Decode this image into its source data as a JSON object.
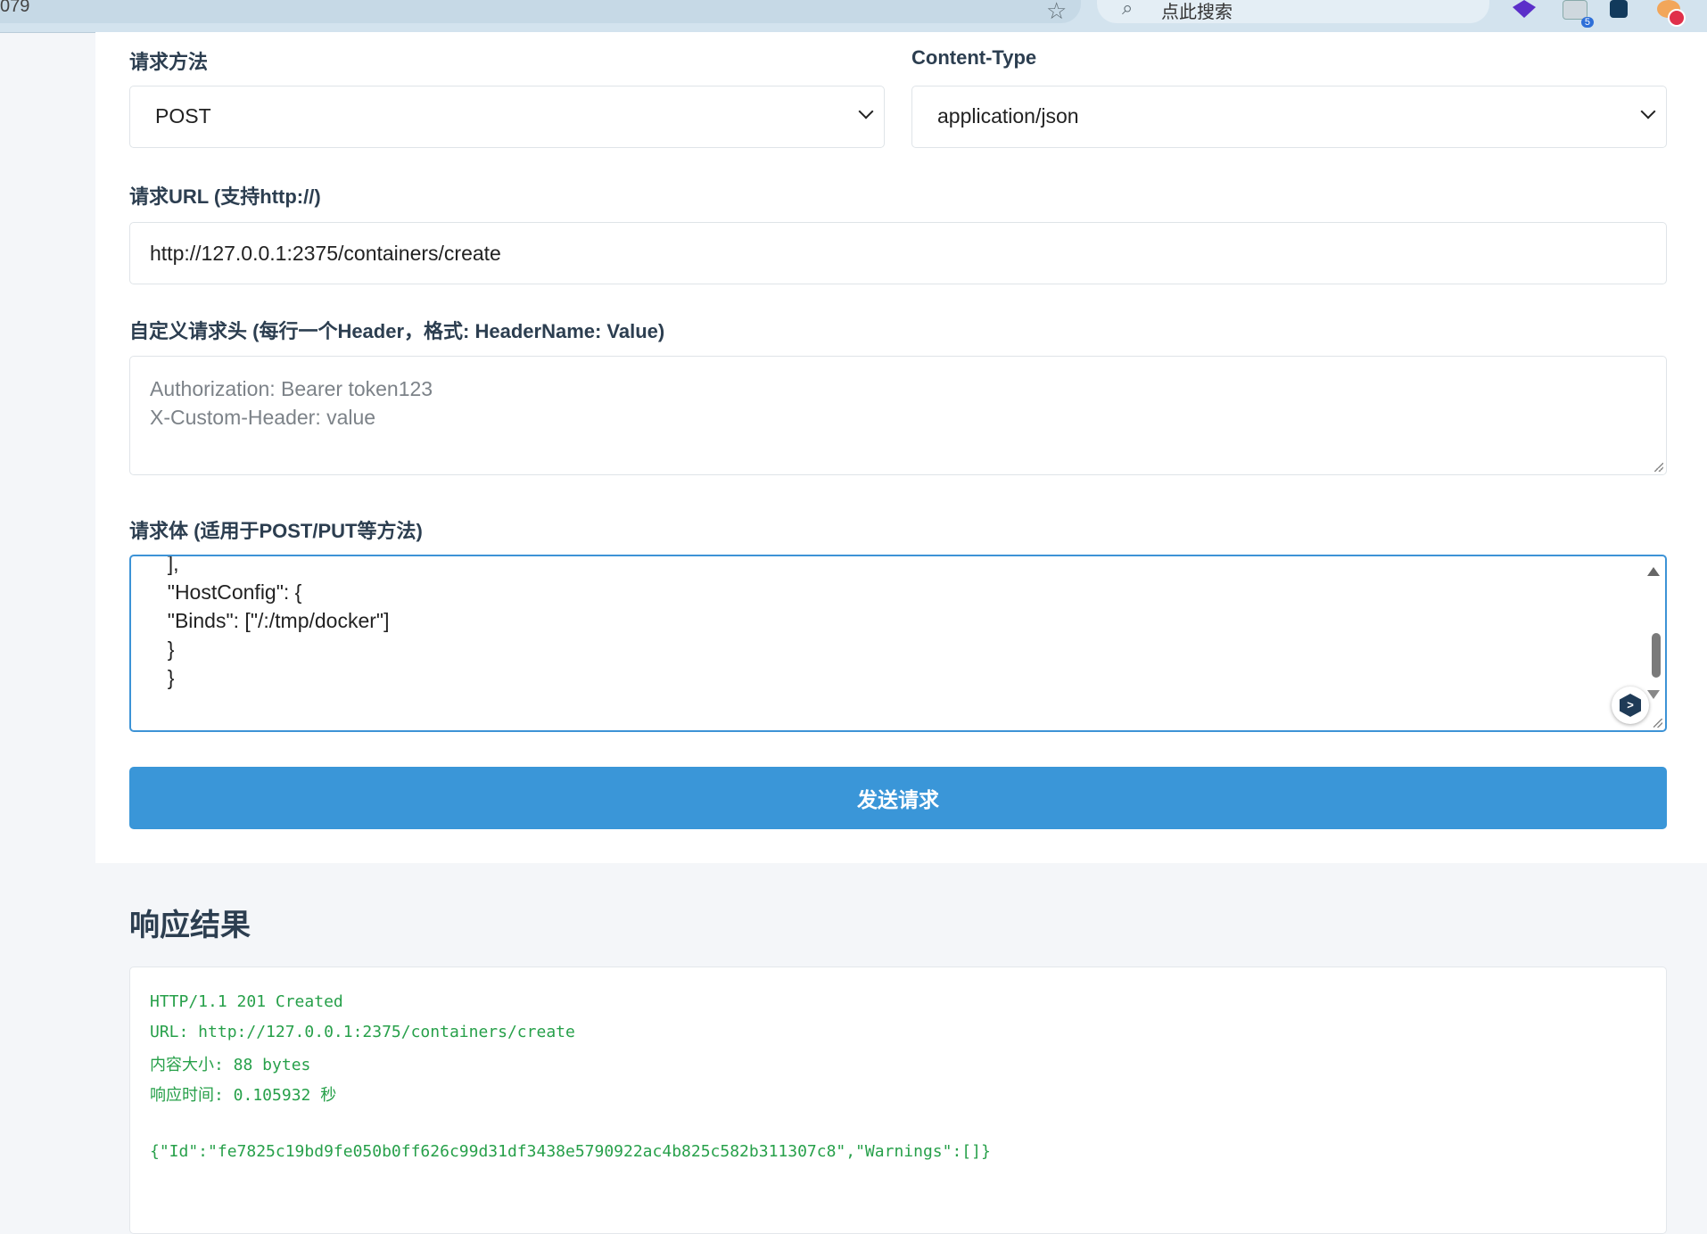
{
  "browser": {
    "url_fragment": "079",
    "search_placeholder": "点此搜索",
    "extension_badge_count": "5"
  },
  "form": {
    "method": {
      "label": "请求方法",
      "value": "POST"
    },
    "content_type": {
      "label": "Content-Type",
      "value": "application/json"
    },
    "url": {
      "label": "请求URL (支持http://)",
      "value": "http://127.0.0.1:2375/containers/create"
    },
    "headers": {
      "label": "自定义请求头 (每行一个Header，格式: HeaderName: Value)",
      "placeholder": "Authorization: Bearer token123\nX-Custom-Header: value"
    },
    "body": {
      "label": "请求体 (适用于POST/PUT等方法)",
      "value": "  ],\n  \"HostConfig\": {\n  \"Binds\": [\"/:/tmp/docker\"]\n  }\n  }"
    },
    "send_button": "发送请求"
  },
  "response": {
    "title": "响应结果",
    "status_line": "HTTP/1.1 201 Created",
    "url_line": "URL: http://127.0.0.1:2375/containers/create",
    "size_line": "内容大小: 88 bytes",
    "time_line": "响应时间: 0.105932 秒",
    "body_line": "{\"Id\":\"fe7825c19bd9fe050b0ff626c99d31df3438e5790922ac4b825c582b311307c8\",\"Warnings\":[]}"
  },
  "colors": {
    "accent": "#3a96d8",
    "response_text": "#27a04a",
    "heading": "#2c3e50"
  }
}
